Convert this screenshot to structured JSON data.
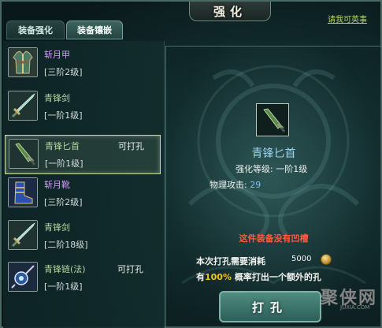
{
  "window": {
    "title": "强化",
    "help_link": "请我可英事"
  },
  "tabs": [
    {
      "label": "装备强化",
      "active": false
    },
    {
      "label": "装备镶嵌",
      "active": true
    }
  ],
  "items": [
    {
      "name": "斩月甲",
      "level": "[三阶2级]",
      "tag": "",
      "icon": "armor-icon"
    },
    {
      "name": "青锋剑",
      "level": "[一阶1级]",
      "tag": "",
      "icon": "sword-icon"
    },
    {
      "name": "青锋匕首",
      "level": "[一阶1级]",
      "tag": "可打孔",
      "icon": "dagger-icon",
      "selected": true
    },
    {
      "name": "斩月靴",
      "level": "[三阶2级]",
      "tag": "",
      "icon": "boots-icon"
    },
    {
      "name": "青锋剑",
      "level": "[二阶18级]",
      "tag": "",
      "icon": "sword-icon"
    },
    {
      "name": "青锋链(法)",
      "level": "[一阶1级]",
      "tag": "可打孔",
      "icon": "necklace-icon"
    }
  ],
  "detail": {
    "item_name": "青锋匕首",
    "strength_label": "强化等级:",
    "strength_value": "一阶1级",
    "attack_label": "物理攻击:",
    "attack_value": "29",
    "warning": "这件装备没有凹槽",
    "cost_label": "本次打孔需要消耗",
    "cost_value": "5000",
    "rate_prefix": "有",
    "rate_value": "100%",
    "rate_suffix": " 概率打出一个额外的孔",
    "punch_button": "打孔"
  },
  "watermark": {
    "text": "聚侠网",
    "url": "JUXIA.COM"
  },
  "colors": {
    "purple_name": "#d79aff",
    "green_name": "#b6d6a0",
    "warning": "#ff5a3c",
    "percent": "#f2c21a",
    "stat_value": "#7fc0e8"
  }
}
